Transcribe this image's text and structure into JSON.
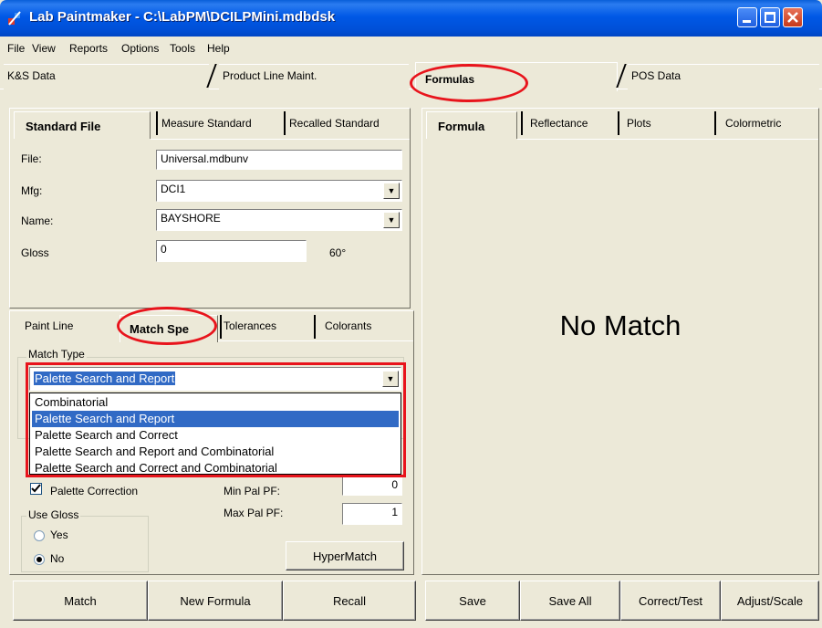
{
  "window": {
    "title": "Lab Paintmaker - C:\\LabPM\\DCILPMini.mdbdsk"
  },
  "menu": [
    {
      "label": "File"
    },
    {
      "label": "View"
    },
    {
      "label": "Reports"
    },
    {
      "label": "Options"
    },
    {
      "label": "Tools"
    },
    {
      "label": "Help"
    }
  ],
  "outer_tabs": [
    {
      "label": "K&S Data"
    },
    {
      "label": "Product Line Maint."
    },
    {
      "label": "Formulas",
      "active": true
    },
    {
      "label": "POS Data"
    }
  ],
  "standard_tabs": [
    {
      "label": "Standard File",
      "active": true
    },
    {
      "label": "Measure Standard"
    },
    {
      "label": "Recalled Standard"
    }
  ],
  "standard": {
    "file_label": "File:",
    "file_value": "Universal.mdbunv",
    "mfg_label": "Mfg:",
    "mfg_value": "DCI1",
    "name_label": "Name:",
    "name_value": "BAYSHORE",
    "gloss_label": "Gloss",
    "gloss_value": "0",
    "gloss_unit": "60°"
  },
  "lower_tabs": [
    {
      "label": "Paint Line"
    },
    {
      "label": "Match Spe",
      "active": true
    },
    {
      "label": "Tolerances"
    },
    {
      "label": "Colorants"
    }
  ],
  "match": {
    "match_type_label": "Match Type",
    "selected": "Palette Search and Report",
    "options": [
      "Combinatorial",
      "Palette Search and Report",
      "Palette Search and Correct",
      "Palette Search and Report and Combinatorial",
      "Palette Search and Correct and Combinatorial"
    ],
    "selected_index": 1,
    "palette_correction_label": "Palette Correction",
    "palette_correction_checked": true,
    "min_pal_pf_label": "Min Pal PF:",
    "min_pal_pf_value": "0",
    "max_pal_pf_label": "Max Pal PF:",
    "max_pal_pf_value": "1",
    "use_gloss_label": "Use Gloss",
    "yes_label": "Yes",
    "no_label": "No",
    "use_gloss_selected": "No",
    "hypermatch_label": "HyperMatch"
  },
  "left_buttons": [
    {
      "label": "Match"
    },
    {
      "label": "New Formula"
    },
    {
      "label": "Recall"
    }
  ],
  "formula_tabs": [
    {
      "label": "Formula",
      "active": true
    },
    {
      "label": "Reflectance"
    },
    {
      "label": "Plots"
    },
    {
      "label": "Colormetric"
    }
  ],
  "formula": {
    "status": "No Match"
  },
  "right_buttons": [
    {
      "label": "Save"
    },
    {
      "label": "Save All"
    },
    {
      "label": "Correct/Test"
    },
    {
      "label": "Adjust/Scale"
    }
  ],
  "colors": {
    "titlebar": "#0058e6",
    "highlight": "#e8141c",
    "selection": "#316ac5",
    "face": "#ece9d8"
  }
}
